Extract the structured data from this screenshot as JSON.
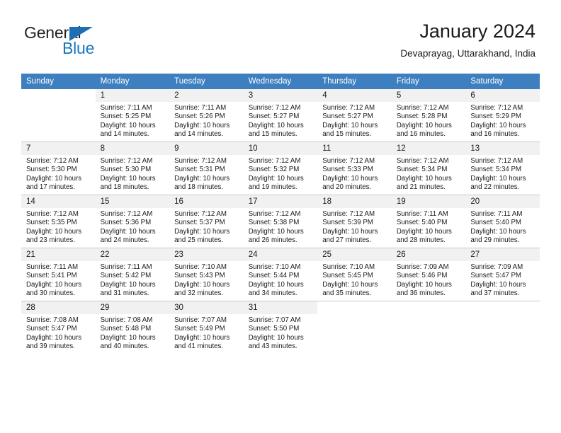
{
  "brand": {
    "word_one": "General",
    "word_two": "Blue",
    "triangle_color": "#1b6fb4"
  },
  "header": {
    "title": "January 2024",
    "subtitle": "Devaprayag, Uttarakhand, India",
    "header_bg": "#3d7fbf",
    "daynum_bg": "#f1f1f1"
  },
  "weekday_headers": [
    "Sunday",
    "Monday",
    "Tuesday",
    "Wednesday",
    "Thursday",
    "Friday",
    "Saturday"
  ],
  "weeks": [
    [
      {
        "day": "",
        "sunrise": "",
        "sunset": "",
        "daylight_line1": "",
        "daylight_line2": ""
      },
      {
        "day": "1",
        "sunrise": "Sunrise: 7:11 AM",
        "sunset": "Sunset: 5:25 PM",
        "daylight_line1": "Daylight: 10 hours",
        "daylight_line2": "and 14 minutes."
      },
      {
        "day": "2",
        "sunrise": "Sunrise: 7:11 AM",
        "sunset": "Sunset: 5:26 PM",
        "daylight_line1": "Daylight: 10 hours",
        "daylight_line2": "and 14 minutes."
      },
      {
        "day": "3",
        "sunrise": "Sunrise: 7:12 AM",
        "sunset": "Sunset: 5:27 PM",
        "daylight_line1": "Daylight: 10 hours",
        "daylight_line2": "and 15 minutes."
      },
      {
        "day": "4",
        "sunrise": "Sunrise: 7:12 AM",
        "sunset": "Sunset: 5:27 PM",
        "daylight_line1": "Daylight: 10 hours",
        "daylight_line2": "and 15 minutes."
      },
      {
        "day": "5",
        "sunrise": "Sunrise: 7:12 AM",
        "sunset": "Sunset: 5:28 PM",
        "daylight_line1": "Daylight: 10 hours",
        "daylight_line2": "and 16 minutes."
      },
      {
        "day": "6",
        "sunrise": "Sunrise: 7:12 AM",
        "sunset": "Sunset: 5:29 PM",
        "daylight_line1": "Daylight: 10 hours",
        "daylight_line2": "and 16 minutes."
      }
    ],
    [
      {
        "day": "7",
        "sunrise": "Sunrise: 7:12 AM",
        "sunset": "Sunset: 5:30 PM",
        "daylight_line1": "Daylight: 10 hours",
        "daylight_line2": "and 17 minutes."
      },
      {
        "day": "8",
        "sunrise": "Sunrise: 7:12 AM",
        "sunset": "Sunset: 5:30 PM",
        "daylight_line1": "Daylight: 10 hours",
        "daylight_line2": "and 18 minutes."
      },
      {
        "day": "9",
        "sunrise": "Sunrise: 7:12 AM",
        "sunset": "Sunset: 5:31 PM",
        "daylight_line1": "Daylight: 10 hours",
        "daylight_line2": "and 18 minutes."
      },
      {
        "day": "10",
        "sunrise": "Sunrise: 7:12 AM",
        "sunset": "Sunset: 5:32 PM",
        "daylight_line1": "Daylight: 10 hours",
        "daylight_line2": "and 19 minutes."
      },
      {
        "day": "11",
        "sunrise": "Sunrise: 7:12 AM",
        "sunset": "Sunset: 5:33 PM",
        "daylight_line1": "Daylight: 10 hours",
        "daylight_line2": "and 20 minutes."
      },
      {
        "day": "12",
        "sunrise": "Sunrise: 7:12 AM",
        "sunset": "Sunset: 5:34 PM",
        "daylight_line1": "Daylight: 10 hours",
        "daylight_line2": "and 21 minutes."
      },
      {
        "day": "13",
        "sunrise": "Sunrise: 7:12 AM",
        "sunset": "Sunset: 5:34 PM",
        "daylight_line1": "Daylight: 10 hours",
        "daylight_line2": "and 22 minutes."
      }
    ],
    [
      {
        "day": "14",
        "sunrise": "Sunrise: 7:12 AM",
        "sunset": "Sunset: 5:35 PM",
        "daylight_line1": "Daylight: 10 hours",
        "daylight_line2": "and 23 minutes."
      },
      {
        "day": "15",
        "sunrise": "Sunrise: 7:12 AM",
        "sunset": "Sunset: 5:36 PM",
        "daylight_line1": "Daylight: 10 hours",
        "daylight_line2": "and 24 minutes."
      },
      {
        "day": "16",
        "sunrise": "Sunrise: 7:12 AM",
        "sunset": "Sunset: 5:37 PM",
        "daylight_line1": "Daylight: 10 hours",
        "daylight_line2": "and 25 minutes."
      },
      {
        "day": "17",
        "sunrise": "Sunrise: 7:12 AM",
        "sunset": "Sunset: 5:38 PM",
        "daylight_line1": "Daylight: 10 hours",
        "daylight_line2": "and 26 minutes."
      },
      {
        "day": "18",
        "sunrise": "Sunrise: 7:12 AM",
        "sunset": "Sunset: 5:39 PM",
        "daylight_line1": "Daylight: 10 hours",
        "daylight_line2": "and 27 minutes."
      },
      {
        "day": "19",
        "sunrise": "Sunrise: 7:11 AM",
        "sunset": "Sunset: 5:40 PM",
        "daylight_line1": "Daylight: 10 hours",
        "daylight_line2": "and 28 minutes."
      },
      {
        "day": "20",
        "sunrise": "Sunrise: 7:11 AM",
        "sunset": "Sunset: 5:40 PM",
        "daylight_line1": "Daylight: 10 hours",
        "daylight_line2": "and 29 minutes."
      }
    ],
    [
      {
        "day": "21",
        "sunrise": "Sunrise: 7:11 AM",
        "sunset": "Sunset: 5:41 PM",
        "daylight_line1": "Daylight: 10 hours",
        "daylight_line2": "and 30 minutes."
      },
      {
        "day": "22",
        "sunrise": "Sunrise: 7:11 AM",
        "sunset": "Sunset: 5:42 PM",
        "daylight_line1": "Daylight: 10 hours",
        "daylight_line2": "and 31 minutes."
      },
      {
        "day": "23",
        "sunrise": "Sunrise: 7:10 AM",
        "sunset": "Sunset: 5:43 PM",
        "daylight_line1": "Daylight: 10 hours",
        "daylight_line2": "and 32 minutes."
      },
      {
        "day": "24",
        "sunrise": "Sunrise: 7:10 AM",
        "sunset": "Sunset: 5:44 PM",
        "daylight_line1": "Daylight: 10 hours",
        "daylight_line2": "and 34 minutes."
      },
      {
        "day": "25",
        "sunrise": "Sunrise: 7:10 AM",
        "sunset": "Sunset: 5:45 PM",
        "daylight_line1": "Daylight: 10 hours",
        "daylight_line2": "and 35 minutes."
      },
      {
        "day": "26",
        "sunrise": "Sunrise: 7:09 AM",
        "sunset": "Sunset: 5:46 PM",
        "daylight_line1": "Daylight: 10 hours",
        "daylight_line2": "and 36 minutes."
      },
      {
        "day": "27",
        "sunrise": "Sunrise: 7:09 AM",
        "sunset": "Sunset: 5:47 PM",
        "daylight_line1": "Daylight: 10 hours",
        "daylight_line2": "and 37 minutes."
      }
    ],
    [
      {
        "day": "28",
        "sunrise": "Sunrise: 7:08 AM",
        "sunset": "Sunset: 5:47 PM",
        "daylight_line1": "Daylight: 10 hours",
        "daylight_line2": "and 39 minutes."
      },
      {
        "day": "29",
        "sunrise": "Sunrise: 7:08 AM",
        "sunset": "Sunset: 5:48 PM",
        "daylight_line1": "Daylight: 10 hours",
        "daylight_line2": "and 40 minutes."
      },
      {
        "day": "30",
        "sunrise": "Sunrise: 7:07 AM",
        "sunset": "Sunset: 5:49 PM",
        "daylight_line1": "Daylight: 10 hours",
        "daylight_line2": "and 41 minutes."
      },
      {
        "day": "31",
        "sunrise": "Sunrise: 7:07 AM",
        "sunset": "Sunset: 5:50 PM",
        "daylight_line1": "Daylight: 10 hours",
        "daylight_line2": "and 43 minutes."
      },
      {
        "day": "",
        "sunrise": "",
        "sunset": "",
        "daylight_line1": "",
        "daylight_line2": ""
      },
      {
        "day": "",
        "sunrise": "",
        "sunset": "",
        "daylight_line1": "",
        "daylight_line2": ""
      },
      {
        "day": "",
        "sunrise": "",
        "sunset": "",
        "daylight_line1": "",
        "daylight_line2": ""
      }
    ]
  ]
}
